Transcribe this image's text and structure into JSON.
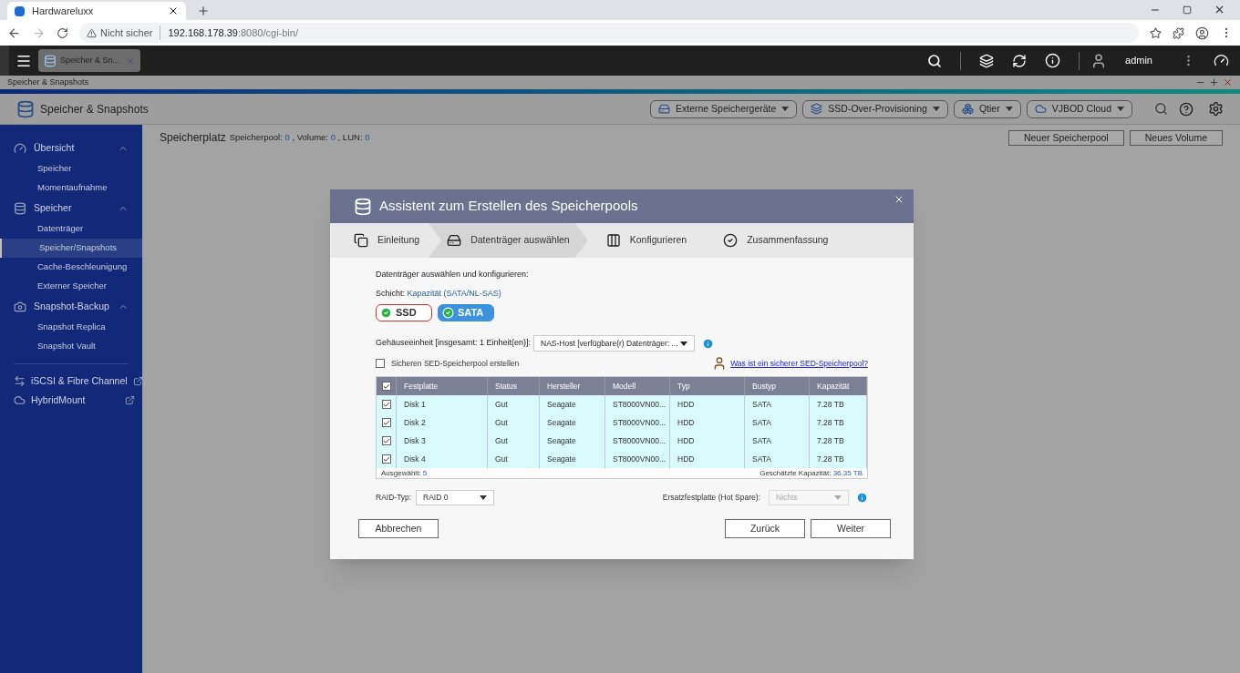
{
  "browser": {
    "tab_title": "Hardwareluxx",
    "security": "Nicht sicher",
    "host": "192.168.178.39",
    "path": ":8080/cgi-bin/"
  },
  "taskbar": {
    "app_tab": "Speicher & Sn...",
    "user": "admin"
  },
  "window_title": "Speicher & Snapshots",
  "app_header": {
    "title": "Speicher & Snapshots",
    "toolbar": [
      {
        "label": "Externe Speichergeräte",
        "kind": "external"
      },
      {
        "label": "SSD-Over-Provisioning",
        "kind": "ssd"
      },
      {
        "label": "Qtier",
        "kind": "qtier"
      },
      {
        "label": "VJBOD Cloud",
        "kind": "cloud"
      }
    ]
  },
  "sidebar": {
    "sections": [
      {
        "label": "Übersicht",
        "kind": "gauge",
        "expanded": true,
        "items": [
          {
            "label": "Speicher",
            "selected": false
          },
          {
            "label": "Momentaufnahme",
            "selected": false
          }
        ]
      },
      {
        "label": "Speicher",
        "kind": "db",
        "expanded": true,
        "items": [
          {
            "label": "Datenträger",
            "selected": false
          },
          {
            "label": "Speicher/Snapshots",
            "selected": true
          },
          {
            "label": "Cache-Beschleunigung",
            "selected": false
          },
          {
            "label": "Externer Speicher",
            "selected": false
          }
        ]
      },
      {
        "label": "Snapshot-Backup",
        "kind": "camera",
        "expanded": true,
        "items": [
          {
            "label": "Snapshot Replica",
            "selected": false
          },
          {
            "label": "Snapshot Vault",
            "selected": false
          }
        ]
      }
    ],
    "links": [
      {
        "label": "iSCSI & Fibre Channel",
        "kind": "iscsi"
      },
      {
        "label": "HybridMount",
        "kind": "cloud"
      }
    ]
  },
  "content": {
    "title": "Speicherplatz",
    "stats": [
      {
        "label": "Speicherpool:",
        "value": "0"
      },
      {
        "label": ", Volume:",
        "value": "0"
      },
      {
        "label": ", LUN:",
        "value": "0"
      }
    ],
    "buttons": [
      "Neuer Speicherpool",
      "Neues Volume"
    ]
  },
  "dialog": {
    "title": "Assistent zum Erstellen des Speicherpools",
    "steps": [
      {
        "label": "Einleitung",
        "kind": "intro",
        "selected": false
      },
      {
        "label": "Datenträger auswählen",
        "kind": "disk",
        "selected": true
      },
      {
        "label": "Konfigurieren",
        "kind": "config",
        "selected": false
      },
      {
        "label": "Zusammenfassung",
        "kind": "summary",
        "selected": false
      }
    ],
    "intro": "Datenträger auswählen und konfigurieren:",
    "tier_label": "Schicht:",
    "tier_value": "Kapazität (SATA/NL-SAS)",
    "tier_buttons": [
      {
        "label": "SSD",
        "selected": false
      },
      {
        "label": "SATA",
        "selected": true
      }
    ],
    "enclosure_label": "Gehäuseeinheit [insgesamt: 1 Einheit(en)]:",
    "enclosure_value": "NAS-Host [verfügbare(r) Datenträger: ...",
    "sed": {
      "label": "Sicheren SED-Speicherpool erstellen",
      "checked": false
    },
    "help_link": "Was ist ein sicherer SED-Speicherpool?",
    "table": {
      "all_checked": true,
      "columns": [
        "Festplatte",
        "Status",
        "Hersteller",
        "Modell",
        "Typ",
        "Bustyp",
        "Kapazität"
      ],
      "rows": [
        {
          "checked": true,
          "cells": [
            "Disk 1",
            "Gut",
            "Seagate",
            "ST8000VN00...",
            "HDD",
            "SATA",
            "7.28 TB"
          ]
        },
        {
          "checked": true,
          "cells": [
            "Disk 2",
            "Gut",
            "Seagate",
            "ST8000VN00...",
            "HDD",
            "SATA",
            "7.28 TB"
          ]
        },
        {
          "checked": true,
          "cells": [
            "Disk 3",
            "Gut",
            "Seagate",
            "ST8000VN00...",
            "HDD",
            "SATA",
            "7.28 TB"
          ]
        },
        {
          "checked": true,
          "cells": [
            "Disk 4",
            "Gut",
            "Seagate",
            "ST8000VN00...",
            "HDD",
            "SATA",
            "7.28 TB"
          ]
        }
      ],
      "selected_label": "Ausgewählt:",
      "selected_count": "5",
      "capacity_label": "Geschätzte Kapazität:",
      "capacity_value": "36.35 TB"
    },
    "raid_label": "RAID-Typ:",
    "raid_value": "RAID 0",
    "spare_label": "Ersatzfestplatte (Hot Spare):",
    "spare_value": "Nichts",
    "spare_disabled": true,
    "buttons": {
      "cancel": "Abbrechen",
      "back": "Zurück",
      "next": "Weiter"
    }
  }
}
